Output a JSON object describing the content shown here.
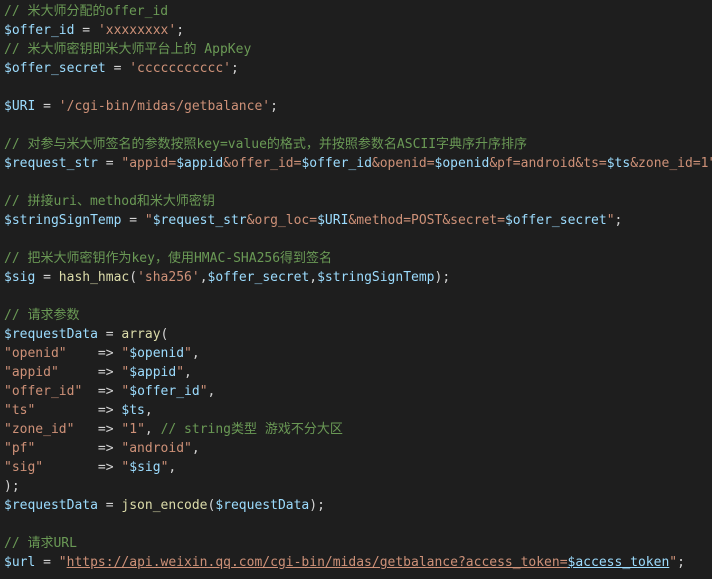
{
  "editor": {
    "lines": [
      [
        {
          "t": "comment",
          "v": "// 米大师分配的offer_id"
        }
      ],
      [
        {
          "t": "var",
          "v": "$offer_id"
        },
        {
          "t": "op",
          "v": " = "
        },
        {
          "t": "str",
          "v": "'xxxxxxxx'"
        },
        {
          "t": "op",
          "v": ";"
        }
      ],
      [
        {
          "t": "comment",
          "v": "// 米大师密钥即米大师平台上的 AppKey"
        }
      ],
      [
        {
          "t": "var",
          "v": "$offer_secret"
        },
        {
          "t": "op",
          "v": " = "
        },
        {
          "t": "str",
          "v": "'ccccccccccc'"
        },
        {
          "t": "op",
          "v": ";"
        }
      ],
      [],
      [
        {
          "t": "var",
          "v": "$URI"
        },
        {
          "t": "op",
          "v": " = "
        },
        {
          "t": "str",
          "v": "'/cgi-bin/midas/getbalance'"
        },
        {
          "t": "op",
          "v": ";"
        }
      ],
      [],
      [
        {
          "t": "comment",
          "v": "// 对参与米大师签名的参数按照key=value的格式，并按照参数名ASCII字典序升序排序"
        }
      ],
      [
        {
          "t": "var",
          "v": "$request_str"
        },
        {
          "t": "op",
          "v": " = "
        },
        {
          "t": "str",
          "v": "\"appid="
        },
        {
          "t": "var",
          "v": "$appid"
        },
        {
          "t": "str",
          "v": "&offer_id="
        },
        {
          "t": "var",
          "v": "$offer_id"
        },
        {
          "t": "str",
          "v": "&openid="
        },
        {
          "t": "var",
          "v": "$openid"
        },
        {
          "t": "str",
          "v": "&pf=android&ts="
        },
        {
          "t": "var",
          "v": "$ts"
        },
        {
          "t": "str",
          "v": "&zone_id=1\""
        },
        {
          "t": "op",
          "v": ";"
        }
      ],
      [],
      [
        {
          "t": "comment",
          "v": "// 拼接uri、method和米大师密钥"
        }
      ],
      [
        {
          "t": "var",
          "v": "$stringSignTemp"
        },
        {
          "t": "op",
          "v": " = "
        },
        {
          "t": "str",
          "v": "\""
        },
        {
          "t": "var",
          "v": "$request_str"
        },
        {
          "t": "str",
          "v": "&org_loc="
        },
        {
          "t": "var",
          "v": "$URI"
        },
        {
          "t": "str",
          "v": "&method=POST&secret="
        },
        {
          "t": "var",
          "v": "$offer_secret"
        },
        {
          "t": "str",
          "v": "\""
        },
        {
          "t": "op",
          "v": ";"
        }
      ],
      [],
      [
        {
          "t": "comment",
          "v": "// 把米大师密钥作为key，使用HMAC-SHA256得到签名"
        }
      ],
      [
        {
          "t": "var",
          "v": "$sig"
        },
        {
          "t": "op",
          "v": " = "
        },
        {
          "t": "fn",
          "v": "hash_hmac"
        },
        {
          "t": "op",
          "v": "("
        },
        {
          "t": "str",
          "v": "'sha256'"
        },
        {
          "t": "op",
          "v": ","
        },
        {
          "t": "var",
          "v": "$offer_secret"
        },
        {
          "t": "op",
          "v": ","
        },
        {
          "t": "var",
          "v": "$stringSignTemp"
        },
        {
          "t": "op",
          "v": ");"
        }
      ],
      [],
      [
        {
          "t": "comment",
          "v": "// 请求参数"
        }
      ],
      [
        {
          "t": "var",
          "v": "$requestData"
        },
        {
          "t": "op",
          "v": " = "
        },
        {
          "t": "fn",
          "v": "array"
        },
        {
          "t": "op",
          "v": "("
        }
      ],
      [
        {
          "t": "str",
          "v": "\"openid\""
        },
        {
          "t": "op",
          "v": "    => "
        },
        {
          "t": "str",
          "v": "\""
        },
        {
          "t": "var",
          "v": "$openid"
        },
        {
          "t": "str",
          "v": "\""
        },
        {
          "t": "op",
          "v": ","
        }
      ],
      [
        {
          "t": "str",
          "v": "\"appid\""
        },
        {
          "t": "op",
          "v": "     => "
        },
        {
          "t": "str",
          "v": "\""
        },
        {
          "t": "var",
          "v": "$appid"
        },
        {
          "t": "str",
          "v": "\""
        },
        {
          "t": "op",
          "v": ","
        }
      ],
      [
        {
          "t": "str",
          "v": "\"offer_id\""
        },
        {
          "t": "op",
          "v": "  => "
        },
        {
          "t": "str",
          "v": "\""
        },
        {
          "t": "var",
          "v": "$offer_id"
        },
        {
          "t": "str",
          "v": "\""
        },
        {
          "t": "op",
          "v": ","
        }
      ],
      [
        {
          "t": "str",
          "v": "\"ts\""
        },
        {
          "t": "op",
          "v": "        => "
        },
        {
          "t": "var",
          "v": "$ts"
        },
        {
          "t": "op",
          "v": ","
        }
      ],
      [
        {
          "t": "str",
          "v": "\"zone_id\""
        },
        {
          "t": "op",
          "v": "   => "
        },
        {
          "t": "str",
          "v": "\"1\""
        },
        {
          "t": "op",
          "v": ", "
        },
        {
          "t": "comment",
          "v": "// string类型 游戏不分大区"
        }
      ],
      [
        {
          "t": "str",
          "v": "\"pf\""
        },
        {
          "t": "op",
          "v": "        => "
        },
        {
          "t": "str",
          "v": "\"android\""
        },
        {
          "t": "op",
          "v": ","
        }
      ],
      [
        {
          "t": "str",
          "v": "\"sig\""
        },
        {
          "t": "op",
          "v": "       => "
        },
        {
          "t": "str",
          "v": "\""
        },
        {
          "t": "var",
          "v": "$sig"
        },
        {
          "t": "str",
          "v": "\""
        },
        {
          "t": "op",
          "v": ","
        }
      ],
      [
        {
          "t": "op",
          "v": ");"
        }
      ],
      [
        {
          "t": "var",
          "v": "$requestData"
        },
        {
          "t": "op",
          "v": " = "
        },
        {
          "t": "fn",
          "v": "json_encode"
        },
        {
          "t": "op",
          "v": "("
        },
        {
          "t": "var",
          "v": "$requestData"
        },
        {
          "t": "op",
          "v": ");"
        }
      ],
      [],
      [
        {
          "t": "comment",
          "v": "// 请求URL"
        }
      ],
      [
        {
          "t": "var",
          "v": "$url"
        },
        {
          "t": "op",
          "v": " = "
        },
        {
          "t": "str",
          "v": "\""
        },
        {
          "t": "link",
          "v": "https://api.weixin.qq.com/cgi-bin/midas/getbalance?access_token="
        },
        {
          "t": "linkvar",
          "v": "$access_token"
        },
        {
          "t": "str",
          "v": "\""
        },
        {
          "t": "op",
          "v": ";"
        }
      ]
    ]
  }
}
